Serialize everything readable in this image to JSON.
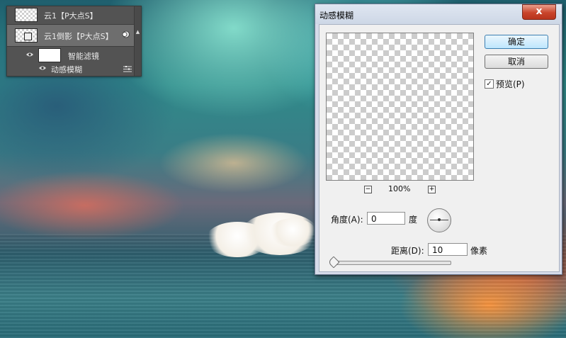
{
  "layers_panel": {
    "layers": [
      {
        "name": "云1【P大点S】",
        "selected": false
      },
      {
        "name": "云1倒影【P大点S】",
        "selected": true
      },
      {
        "name": "智能滤镜",
        "selected": false
      },
      {
        "name": "动感模糊",
        "selected": false
      }
    ],
    "icons": {
      "visibility": "eye-icon",
      "smart_object": "smart-object-icon",
      "filter_options": "filter-options-icon",
      "scroll_up": "scroll-up-arrow-icon"
    }
  },
  "dialog": {
    "title": "动感模糊",
    "close_label": "x",
    "ok_label": "确定",
    "cancel_label": "取消",
    "preview_checked": true,
    "preview_label": "预览(P)",
    "zoom_out_label": "−",
    "zoom_in_label": "+",
    "zoom_level": "100%",
    "angle_label": "角度(A):",
    "angle_value": "0",
    "angle_unit": "度",
    "distance_label": "距离(D):",
    "distance_value": "10",
    "distance_unit": "像素",
    "distance_slider_fraction": 0.0
  },
  "colors": {
    "panel_bg": "#535353",
    "selected_layer": "#6e6e6e",
    "dialog_bg": "#f0f0f0",
    "close_button": "#c9442b",
    "primary_button": "#bee6fd"
  }
}
